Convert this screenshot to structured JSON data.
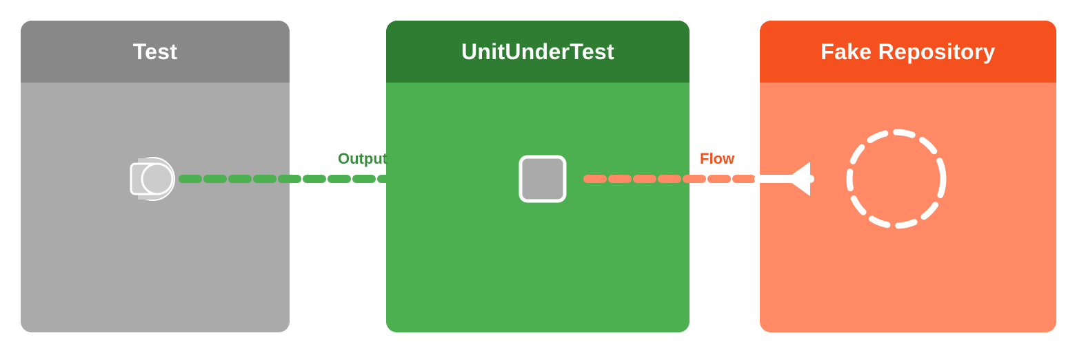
{
  "boxes": {
    "test": {
      "title": "Test",
      "header_color": "#888888",
      "body_color": "#aaaaaa"
    },
    "uut": {
      "title": "UnitUnderTest",
      "header_color": "#2e7d32",
      "body_color": "#4caf50"
    },
    "fake": {
      "title": "Fake Repository",
      "header_color": "#f4511e",
      "body_color": "#ff8a65"
    }
  },
  "labels": {
    "output": "Output",
    "flow": "Flow"
  },
  "colors": {
    "green_line": "#4caf50",
    "orange_line": "#ff8a65",
    "white": "#ffffff",
    "output_text": "#388e3c",
    "flow_text": "#f4511e"
  }
}
